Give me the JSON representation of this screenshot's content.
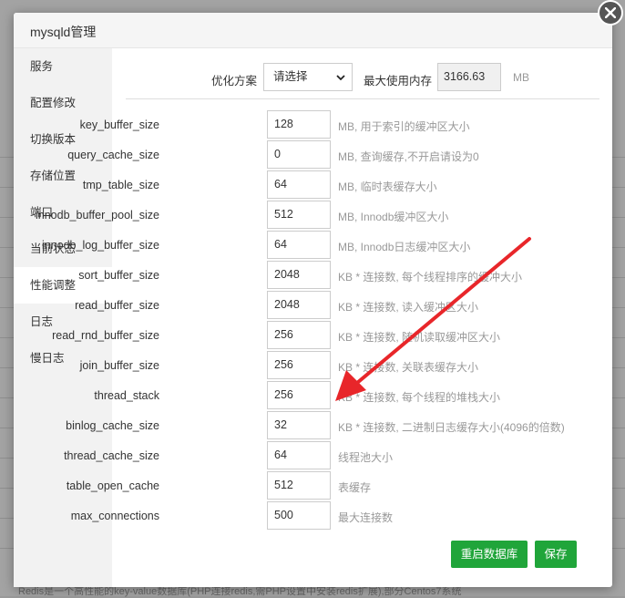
{
  "window": {
    "title": "mysqld管理"
  },
  "background": {
    "footer_text": "Redis是一个高性能的key-value数据库(PHP连接redis,需PHP设置中安装redis扩展),部分Centos7系统"
  },
  "sidebar": {
    "items": [
      {
        "label": "服务",
        "active": false
      },
      {
        "label": "配置修改",
        "active": false
      },
      {
        "label": "切换版本",
        "active": false
      },
      {
        "label": "存储位置",
        "active": false
      },
      {
        "label": "端口",
        "active": false
      },
      {
        "label": "当前状态",
        "active": false
      },
      {
        "label": "性能调整",
        "active": true
      },
      {
        "label": "日志",
        "active": false
      },
      {
        "label": "慢日志",
        "active": false
      }
    ]
  },
  "optimization": {
    "label": "优化方案",
    "selected": "请选择",
    "max_mem_label": "最大使用内存",
    "max_mem_value": "3166.63",
    "max_mem_unit": "MB"
  },
  "params": [
    {
      "name": "key_buffer_size",
      "value": "128",
      "desc": "MB, 用于索引的缓冲区大小"
    },
    {
      "name": "query_cache_size",
      "value": "0",
      "desc": "MB, 查询缓存,不开启请设为0"
    },
    {
      "name": "tmp_table_size",
      "value": "64",
      "desc": "MB, 临时表缓存大小"
    },
    {
      "name": "innodb_buffer_pool_size",
      "value": "512",
      "desc": "MB, Innodb缓冲区大小"
    },
    {
      "name": "innodb_log_buffer_size",
      "value": "64",
      "desc": "MB, Innodb日志缓冲区大小"
    },
    {
      "name": "sort_buffer_size",
      "value": "2048",
      "desc": "KB * 连接数, 每个线程排序的缓冲大小"
    },
    {
      "name": "read_buffer_size",
      "value": "2048",
      "desc": "KB * 连接数, 读入缓冲区大小"
    },
    {
      "name": "read_rnd_buffer_size",
      "value": "256",
      "desc": "KB * 连接数, 随机读取缓冲区大小"
    },
    {
      "name": "join_buffer_size",
      "value": "256",
      "desc": "KB * 连接数, 关联表缓存大小"
    },
    {
      "name": "thread_stack",
      "value": "256",
      "desc": "KB * 连接数, 每个线程的堆栈大小"
    },
    {
      "name": "binlog_cache_size",
      "value": "32",
      "desc": "KB * 连接数, 二进制日志缓存大小(4096的倍数)"
    },
    {
      "name": "thread_cache_size",
      "value": "64",
      "desc": "线程池大小"
    },
    {
      "name": "table_open_cache",
      "value": "512",
      "desc": "表缓存"
    },
    {
      "name": "max_connections",
      "value": "500",
      "desc": "最大连接数"
    }
  ],
  "buttons": {
    "restart": "重启数据库",
    "save": "保存"
  },
  "colors": {
    "primary": "#20a53a",
    "annotation_arrow": "#e8262a"
  },
  "icons": {
    "close": "close-icon",
    "dropdown": "chevron-down-icon",
    "annotation": "red-arrow"
  }
}
